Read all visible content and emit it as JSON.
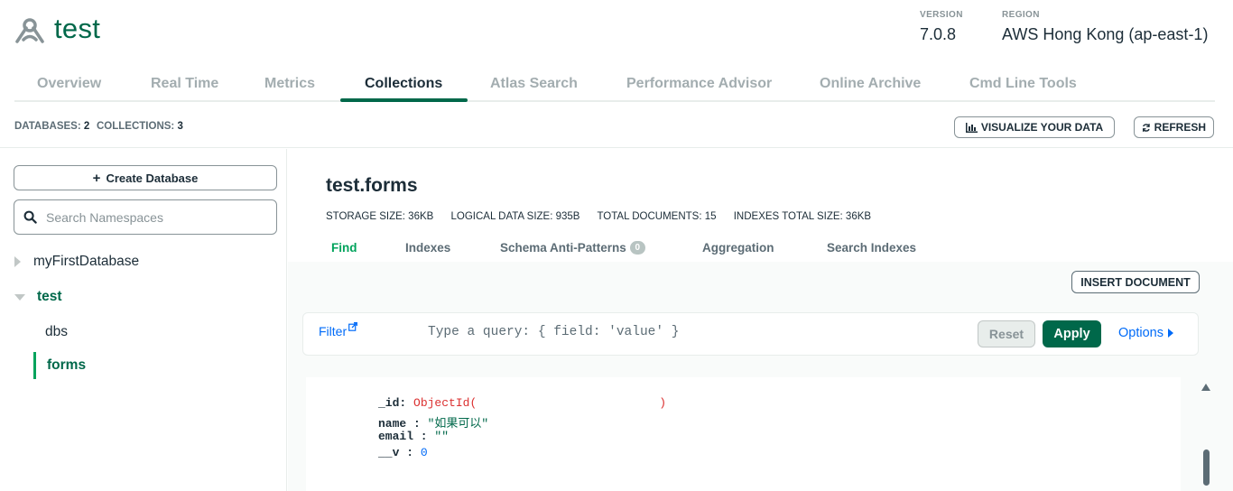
{
  "header": {
    "cluster_name": "test",
    "version_label": "VERSION",
    "version": "7.0.8",
    "region_label": "REGION",
    "region": "AWS Hong Kong (ap-east-1)"
  },
  "tabs": [
    {
      "label": "Overview"
    },
    {
      "label": "Real Time"
    },
    {
      "label": "Metrics"
    },
    {
      "label": "Collections",
      "active": true
    },
    {
      "label": "Atlas Search"
    },
    {
      "label": "Performance Advisor"
    },
    {
      "label": "Online Archive"
    },
    {
      "label": "Cmd Line Tools"
    }
  ],
  "stats": {
    "databases_label": "DATABASES:",
    "databases": "2",
    "collections_label": "COLLECTIONS:",
    "collections": "3",
    "visualize_label": "VISUALIZE YOUR DATA",
    "refresh_label": "REFRESH"
  },
  "sidebar": {
    "create_label": "Create Database",
    "search_placeholder": "Search Namespaces",
    "tree": [
      {
        "label": "myFirstDatabase",
        "expanded": false
      },
      {
        "label": "test",
        "expanded": true
      },
      {
        "label": "dbs"
      },
      {
        "label": "forms",
        "selected": true
      }
    ]
  },
  "collection": {
    "title": "test.forms",
    "storage_size": "STORAGE SIZE: 36KB",
    "logical_size": "LOGICAL DATA SIZE: 935B",
    "total_documents": "TOTAL DOCUMENTS: 15",
    "indexes_size": "INDEXES TOTAL SIZE: 36KB",
    "subtabs": [
      {
        "label": "Find",
        "active": true
      },
      {
        "label": "Indexes"
      },
      {
        "label": "Schema Anti-Patterns",
        "badge": "0"
      },
      {
        "label": "Aggregation"
      },
      {
        "label": "Search Indexes"
      }
    ],
    "insert_label": "INSERT DOCUMENT"
  },
  "query": {
    "filter_label": "Filter",
    "placeholder": "Type a query: { field: 'value' }",
    "reset_label": "Reset",
    "apply_label": "Apply",
    "options_label": "Options"
  },
  "document": {
    "id_key": "_id:",
    "id_value_open": "ObjectId(",
    "id_value_close": ")",
    "name_key": "name :",
    "name_value": "\"如果可以\"",
    "email_key": "email :",
    "email_value": "\"\"",
    "v_key": "__v :",
    "v_value": "0"
  },
  "colors": {
    "brand_green": "#00684a",
    "accent_green": "#00a35c",
    "link_blue": "#016bf8",
    "objectid_red": "#db3030"
  }
}
